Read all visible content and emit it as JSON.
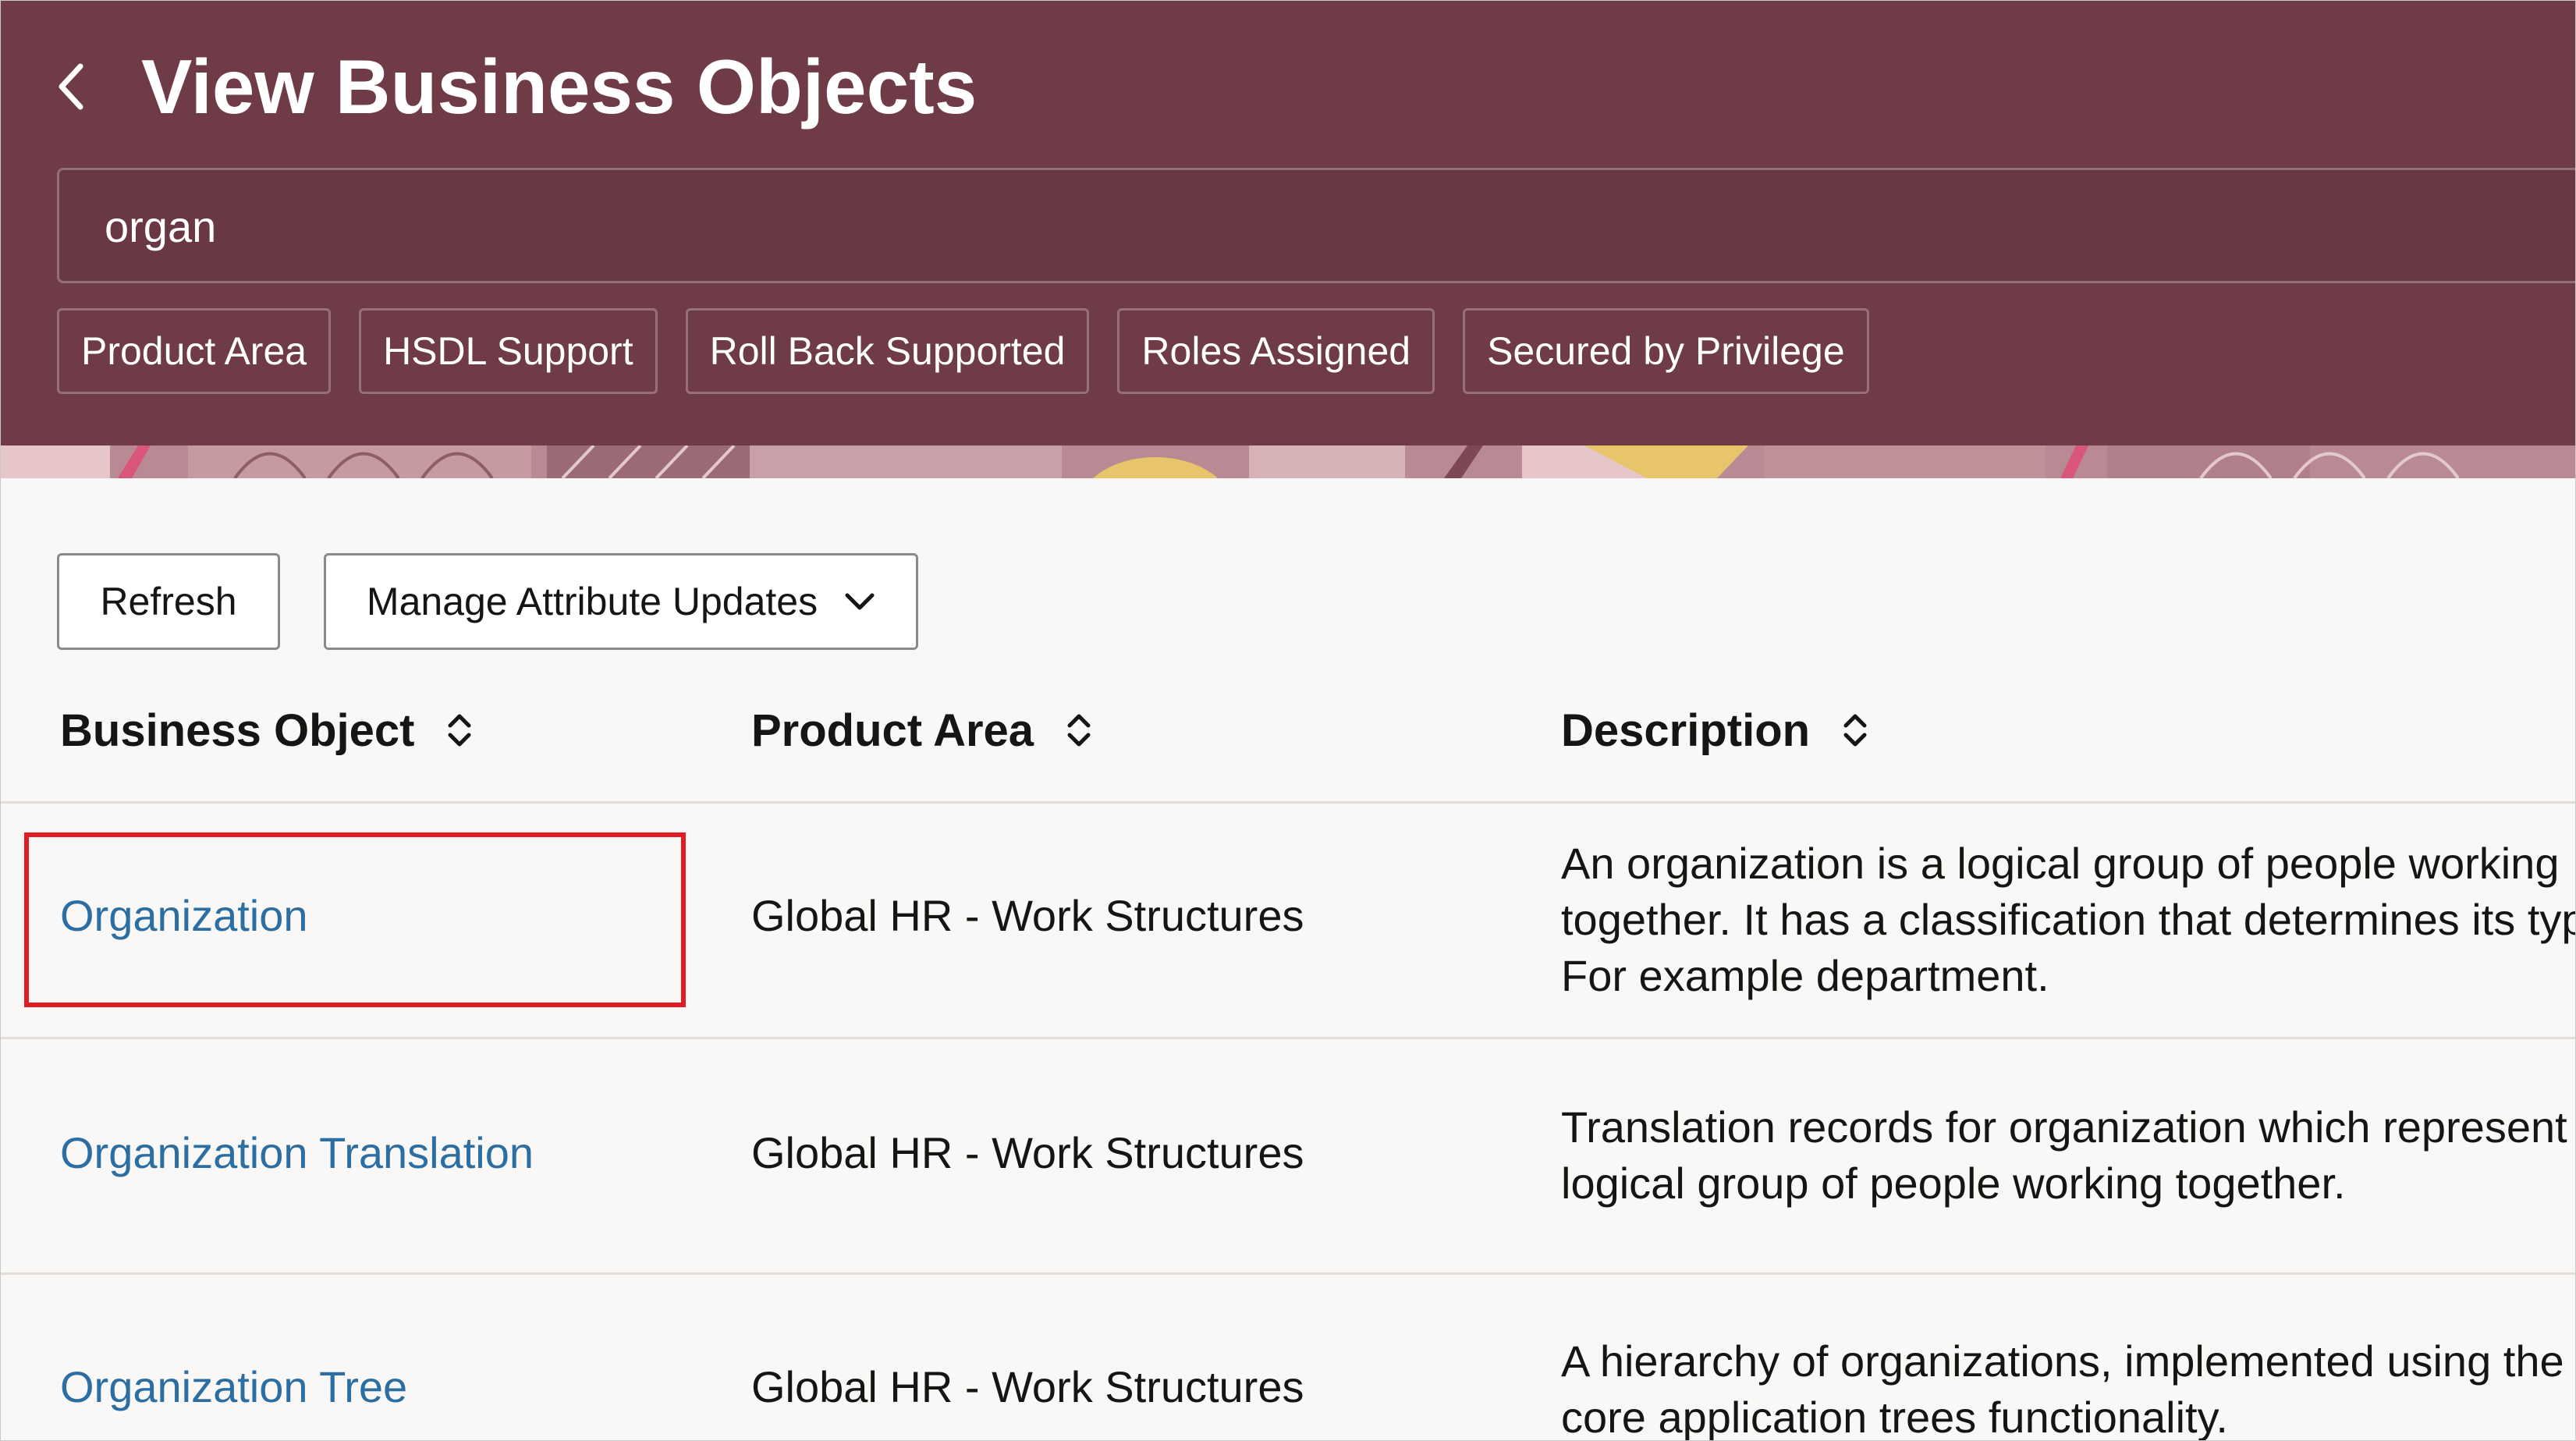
{
  "header": {
    "title": "View Business Objects",
    "back_icon": "chevron-left-icon",
    "background_color": "#6e3b47"
  },
  "search": {
    "value": "organ"
  },
  "filters": [
    {
      "label": "Product Area"
    },
    {
      "label": "HSDL Support"
    },
    {
      "label": "Roll Back Supported"
    },
    {
      "label": "Roles Assigned"
    },
    {
      "label": "Secured by Privilege"
    }
  ],
  "toolbar": {
    "refresh_label": "Refresh",
    "manage_label": "Manage Attribute Updates",
    "manage_icon": "chevron-down-icon"
  },
  "table": {
    "columns": [
      {
        "label": "Business Object",
        "sort_icon": "sort-icon"
      },
      {
        "label": "Product Area",
        "sort_icon": "sort-icon"
      },
      {
        "label": "Description",
        "sort_icon": "sort-icon"
      }
    ],
    "rows": [
      {
        "business_object": "Organization",
        "product_area": "Global HR - Work Structures",
        "description": [
          "An organization is a logical group of people working",
          "together. It has a classification that determines its typ",
          "For example department."
        ]
      },
      {
        "business_object": "Organization Translation",
        "product_area": "Global HR - Work Structures",
        "description": [
          "Translation records for organization which represent",
          "logical group of people working together."
        ]
      },
      {
        "business_object": "Organization Tree",
        "product_area": "Global HR - Work Structures",
        "description": [
          "A hierarchy of organizations, implemented using the",
          "core application trees functionality."
        ]
      }
    ]
  },
  "colors": {
    "link": "#2b6ea3",
    "highlight": "#e31b23"
  }
}
